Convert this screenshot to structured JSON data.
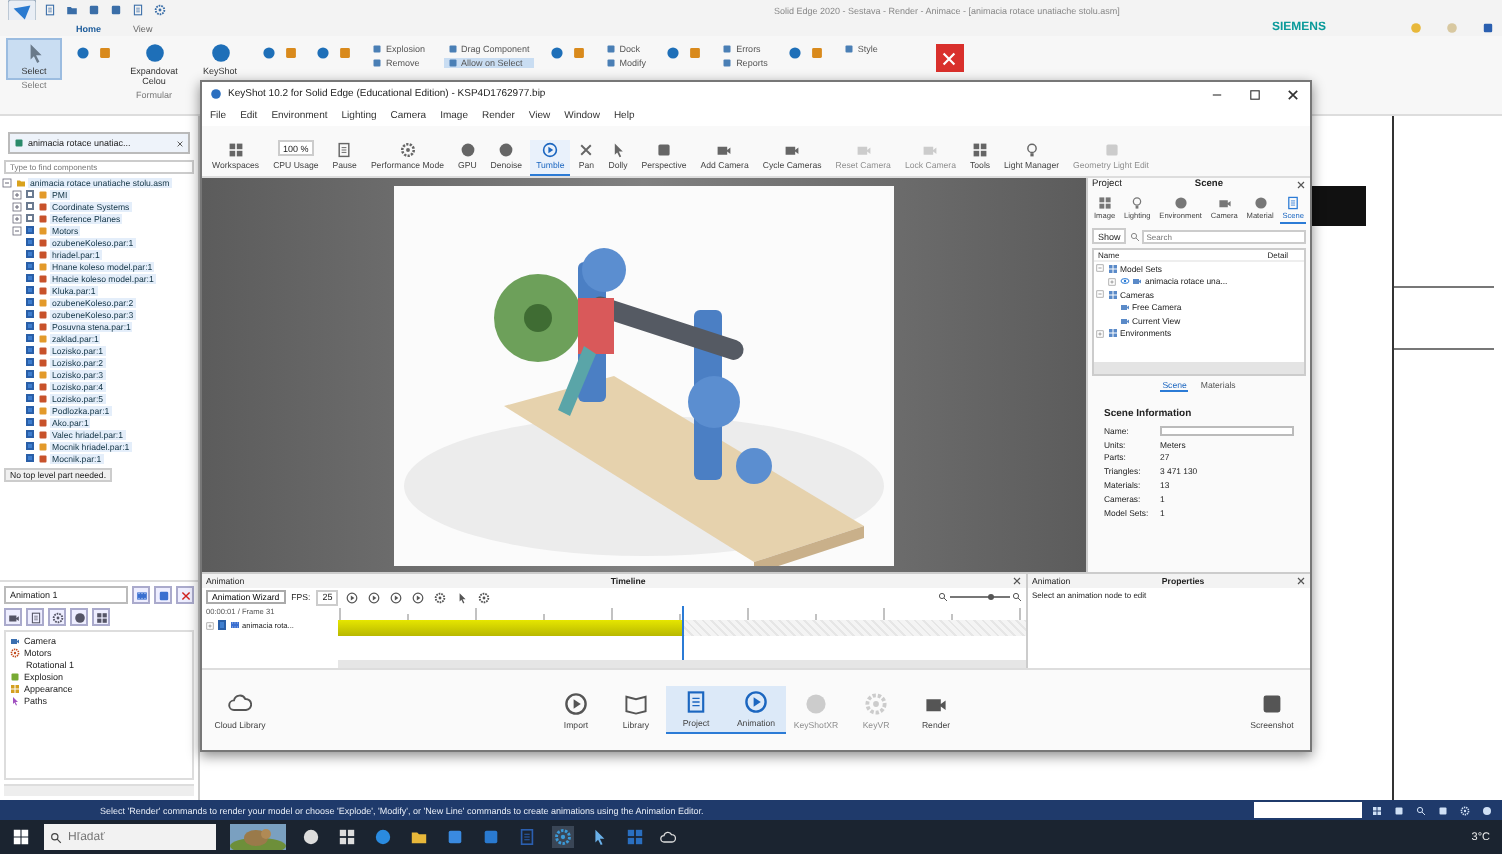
{
  "solid_edge": {
    "title": "Solid Edge 2020 - Sestava - Render - Animace - [animacia rotace unatiache stolu.asm]",
    "tabs": [
      {
        "label": "Home",
        "selected": true
      },
      {
        "label": "View",
        "selected": false
      }
    ],
    "brand": "SIEMENS",
    "ribbon": [
      {
        "kind": "big",
        "label": "Select",
        "group": "Select",
        "selected": true
      },
      {
        "kind": "icons"
      },
      {
        "kind": "big",
        "label": "Expandovat Celou",
        "group": "Formular",
        "selected": false
      },
      {
        "kind": "big",
        "label": "KeyShot",
        "selected": false
      },
      {
        "kind": "icons"
      },
      {
        "kind": "icons"
      },
      {
        "kind": "pair",
        "labels": [
          {
            "label": "Explosion",
            "selected": false
          },
          {
            "label": "Remove",
            "selected": false
          }
        ]
      },
      {
        "kind": "pair",
        "labels": [
          {
            "label": "Drag Component",
            "selected": false
          },
          {
            "label": "Allow on Select",
            "selected": true
          }
        ]
      },
      {
        "kind": "icons"
      },
      {
        "kind": "pair",
        "labels": [
          {
            "label": "Dock",
            "selected": false
          },
          {
            "label": "Modify",
            "selected": false
          }
        ]
      },
      {
        "kind": "icons"
      },
      {
        "kind": "pair",
        "labels": [
          {
            "label": "Errors",
            "selected": false
          },
          {
            "label": "Reports",
            "selected": false
          }
        ]
      },
      {
        "kind": "icons"
      },
      {
        "kind": "pair",
        "labels": [
          {
            "label": "Style",
            "selected": false
          }
        ]
      },
      {
        "kind": "close"
      }
    ],
    "doc_tab": "animacia rotace unatiac...",
    "search": {
      "placeholder": "Type to find components"
    },
    "tree": [
      {
        "label": "animacia rotace unatiache stolu.asm",
        "expanded": true,
        "children": [
          {
            "label": "PMI",
            "checked": false,
            "expanded": false
          },
          {
            "label": "Coordinate Systems",
            "checked": false,
            "expanded": false
          },
          {
            "label": "Reference Planes",
            "checked": false,
            "expanded": false
          },
          {
            "label": "Motors",
            "checked": true,
            "expanded": true
          },
          {
            "label": "ozubeneKoleso.par:1",
            "checked": true
          },
          {
            "label": "hriadel.par:1",
            "checked": true
          },
          {
            "label": "Hnane koleso model.par:1",
            "checked": true
          },
          {
            "label": "Hnacie koleso model.par:1",
            "checked": true
          },
          {
            "label": "Kluka.par:1",
            "checked": true
          },
          {
            "label": "ozubeneKoleso.par:2",
            "checked": true
          },
          {
            "label": "ozubeneKoleso.par:3",
            "checked": true
          },
          {
            "label": "Posuvna stena.par:1",
            "checked": true
          },
          {
            "label": "zaklad.par:1",
            "checked": true
          },
          {
            "label": "Lozisko.par:1",
            "checked": true
          },
          {
            "label": "Lozisko.par:2",
            "checked": true
          },
          {
            "label": "Lozisko.par:3",
            "checked": true
          },
          {
            "label": "Lozisko.par:4",
            "checked": true
          },
          {
            "label": "Lozisko.par:5",
            "checked": true
          },
          {
            "label": "Podlozka.par:1",
            "checked": true
          },
          {
            "label": "Ako.par:1",
            "checked": true
          },
          {
            "label": "Valec hriadel.par:1",
            "checked": true
          },
          {
            "label": "Mocnik hriadel.par:1",
            "checked": true
          },
          {
            "label": "Mocnik.par:1",
            "checked": true
          }
        ]
      }
    ],
    "tree_note": "No top level part needed.",
    "animation": {
      "select": "Animation 1",
      "items": [
        {
          "label": "Camera"
        },
        {
          "label": "Motors",
          "children": [
            {
              "label": "Rotational 1"
            }
          ]
        },
        {
          "label": "Explosion"
        },
        {
          "label": "Appearance"
        },
        {
          "label": "Paths"
        }
      ]
    },
    "status": "Select 'Render' commands to render your model or choose 'Explode', 'Modify', or 'New Line' commands to create animations using the Animation Editor.",
    "taskbar": {
      "search": {
        "placeholder": "Hľadať"
      },
      "weather": "3°C"
    }
  },
  "keyshot": {
    "title": "KeyShot 10.2 for Solid Edge (Educational Edition) - KSP4D1762977.bip",
    "menu": [
      "File",
      "Edit",
      "Environment",
      "Lighting",
      "Camera",
      "Image",
      "Render",
      "View",
      "Window",
      "Help"
    ],
    "cpu_value": "100 %",
    "toolbar": [
      {
        "label": "Workspaces",
        "selected": false,
        "disabled": false
      },
      {
        "label": "CPU Usage",
        "selected": false,
        "disabled": false
      },
      {
        "label": "Pause",
        "selected": false,
        "disabled": false
      },
      {
        "label": "Performance Mode",
        "selected": false,
        "disabled": false
      },
      {
        "label": "GPU",
        "selected": false,
        "disabled": false
      },
      {
        "label": "Denoise",
        "selected": false,
        "disabled": false
      },
      {
        "label": "Tumble",
        "selected": true,
        "disabled": false
      },
      {
        "label": "Pan",
        "selected": false,
        "disabled": false
      },
      {
        "label": "Dolly",
        "selected": false,
        "disabled": false
      },
      {
        "label": "Perspective",
        "selected": false,
        "disabled": false
      },
      {
        "label": "Add Camera",
        "selected": false,
        "disabled": false
      },
      {
        "label": "Cycle Cameras",
        "selected": false,
        "disabled": false
      },
      {
        "label": "Reset Camera",
        "selected": false,
        "disabled": true
      },
      {
        "label": "Lock Camera",
        "selected": false,
        "disabled": true
      },
      {
        "label": "Tools",
        "selected": false,
        "disabled": false
      },
      {
        "label": "Light Manager",
        "selected": false,
        "disabled": false
      },
      {
        "label": "Geometry Light Edit",
        "selected": false,
        "disabled": true
      }
    ],
    "project": {
      "title": "Project",
      "heading": "Scene",
      "tabs": [
        {
          "label": "Image",
          "selected": false
        },
        {
          "label": "Lighting",
          "selected": false
        },
        {
          "label": "Environment",
          "selected": false
        },
        {
          "label": "Camera",
          "selected": false
        },
        {
          "label": "Material",
          "selected": false
        },
        {
          "label": "Scene",
          "selected": true
        }
      ],
      "show": "Show",
      "search": {
        "placeholder": "Search"
      },
      "columns": [
        "Name",
        "Detail"
      ],
      "tree": [
        {
          "label": "Model Sets",
          "expanded": true,
          "children": [
            {
              "label": "animacia rotace una...",
              "expanded": false
            }
          ]
        },
        {
          "label": "Cameras",
          "expanded": true,
          "children": [
            {
              "label": "Free Camera"
            },
            {
              "label": "Current View"
            }
          ]
        },
        {
          "label": "Environments",
          "expanded": false
        }
      ],
      "subtabs": [
        {
          "label": "Scene",
          "selected": true
        },
        {
          "label": "Materials",
          "selected": false
        }
      ],
      "info_title": "Scene Information",
      "info": [
        {
          "kind": "field",
          "label": "Name:"
        },
        {
          "kind": "text",
          "label": "Units:",
          "value": "Meters"
        },
        {
          "kind": "text",
          "label": "Parts:",
          "value": "27"
        },
        {
          "kind": "text",
          "label": "Triangles:",
          "value": "3 471 130"
        },
        {
          "kind": "text",
          "label": "Materials:",
          "value": "13"
        },
        {
          "kind": "text",
          "label": "Cameras:",
          "value": "1"
        },
        {
          "kind": "text",
          "label": "Model Sets:",
          "value": "1"
        }
      ]
    },
    "timeline": {
      "panel": "Animation",
      "title": "Timeline",
      "wizard": "Animation Wizard",
      "fps_label": "FPS:",
      "fps": "25",
      "time": "00:00:01 / Frame 31",
      "zoom": {
        "level": 0.67
      },
      "clip": {
        "label": "animacia rota...",
        "checked": true
      }
    },
    "properties": {
      "panel": "Animation",
      "title": "Properties",
      "hint": "Select an animation node to edit"
    },
    "bottom": [
      {
        "label": "Cloud Library",
        "selected": false,
        "disabled": false
      },
      {
        "label": "Import",
        "selected": false,
        "disabled": false
      },
      {
        "label": "Library",
        "selected": false,
        "disabled": false
      },
      {
        "label": "Project",
        "selected": true,
        "disabled": false
      },
      {
        "label": "Animation",
        "selected": true,
        "disabled": false
      },
      {
        "label": "KeyShotXR",
        "selected": false,
        "disabled": true
      },
      {
        "label": "KeyVR",
        "selected": false,
        "disabled": true
      },
      {
        "label": "Render",
        "selected": false,
        "disabled": false
      },
      {
        "label": "Screenshot",
        "selected": false,
        "disabled": false
      }
    ]
  }
}
